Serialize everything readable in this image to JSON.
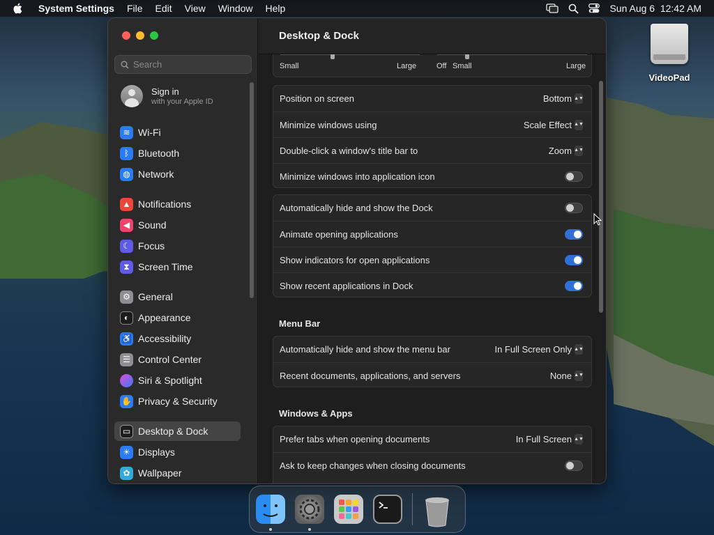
{
  "menubar": {
    "app_name": "System Settings",
    "menus": [
      "File",
      "Edit",
      "View",
      "Window",
      "Help"
    ],
    "datetime": "Sun Aug 6  12:42 AM"
  },
  "desktop": {
    "icon_label": "VideoPad"
  },
  "window": {
    "title": "Desktop & Dock"
  },
  "sidebar": {
    "search_placeholder": "Search",
    "signin": {
      "title": "Sign in",
      "subtitle": "with your Apple ID"
    },
    "items": [
      {
        "label": "Wi-Fi",
        "color": "#2a7bf6"
      },
      {
        "label": "Bluetooth",
        "color": "#2a7bf6"
      },
      {
        "label": "Network",
        "color": "#2a7bf6"
      },
      {
        "label": "Notifications",
        "color": "#f0453a"
      },
      {
        "label": "Sound",
        "color": "#f0436b"
      },
      {
        "label": "Focus",
        "color": "#5e5ce6"
      },
      {
        "label": "Screen Time",
        "color": "#5e5ce6"
      },
      {
        "label": "General",
        "color": "#8e8e93"
      },
      {
        "label": "Appearance",
        "color": "#1c1c1c"
      },
      {
        "label": "Accessibility",
        "color": "#2a7bf6"
      },
      {
        "label": "Control Center",
        "color": "#8e8e93"
      },
      {
        "label": "Siri & Spotlight",
        "color": "#b04ad8"
      },
      {
        "label": "Privacy & Security",
        "color": "#2a7bf6"
      },
      {
        "label": "Desktop & Dock",
        "color": "#1c1c1c",
        "selected": true
      },
      {
        "label": "Displays",
        "color": "#2a7bf6"
      },
      {
        "label": "Wallpaper",
        "color": "#34aadc"
      }
    ]
  },
  "sliders": {
    "size": {
      "min_label": "Small",
      "max_label": "Large"
    },
    "magnification": {
      "off_label": "Off",
      "min_label": "Small",
      "max_label": "Large"
    }
  },
  "dock_group1": [
    {
      "label": "Position on screen",
      "value": "Bottom"
    },
    {
      "label": "Minimize windows using",
      "value": "Scale Effect"
    },
    {
      "label": "Double-click a window's title bar to",
      "value": "Zoom"
    },
    {
      "label": "Minimize windows into application icon",
      "toggle": false
    }
  ],
  "dock_group2": [
    {
      "label": "Automatically hide and show the Dock",
      "toggle": false
    },
    {
      "label": "Animate opening applications",
      "toggle": true
    },
    {
      "label": "Show indicators for open applications",
      "toggle": true
    },
    {
      "label": "Show recent applications in Dock",
      "toggle": true
    }
  ],
  "menu_bar": {
    "heading": "Menu Bar",
    "rows": [
      {
        "label": "Automatically hide and show the menu bar",
        "value": "In Full Screen Only"
      },
      {
        "label": "Recent documents, applications, and servers",
        "value": "None"
      }
    ]
  },
  "windows_apps": {
    "heading": "Windows & Apps",
    "rows": [
      {
        "label": "Prefer tabs when opening documents",
        "value": "In Full Screen"
      },
      {
        "label": "Ask to keep changes when closing documents",
        "toggle": false
      }
    ]
  },
  "dock_apps": [
    "Finder",
    "System Settings",
    "Launchpad",
    "Terminal",
    "Trash"
  ]
}
